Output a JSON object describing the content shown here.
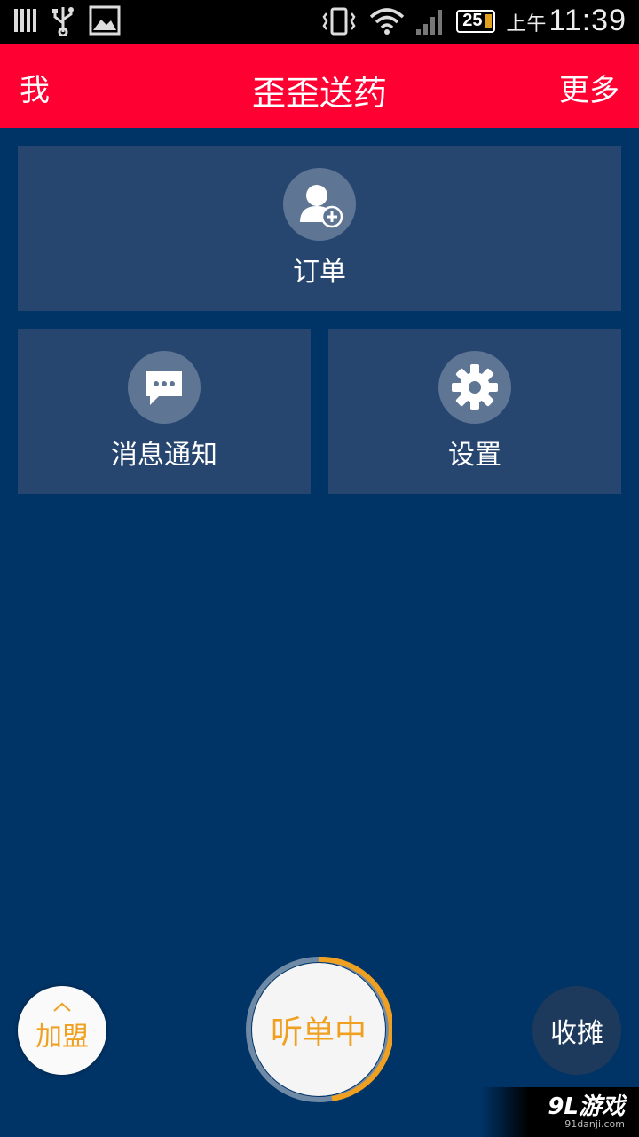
{
  "status_bar": {
    "battery_level": "25",
    "time_prefix": "上午",
    "time": "11:39",
    "icons": [
      "signal-bars-icon",
      "usb-icon",
      "image-icon",
      "vibrate-icon",
      "wifi-icon",
      "cell-signal-icon",
      "battery-icon"
    ]
  },
  "header": {
    "left_label": "我",
    "title": "歪歪送药",
    "right_label": "更多",
    "background": "#ff0033"
  },
  "tiles": {
    "orders": {
      "label": "订单",
      "icon": "user-add-icon"
    },
    "messages": {
      "label": "消息通知",
      "icon": "chat-bubble-icon"
    },
    "settings": {
      "label": "设置",
      "icon": "gear-icon"
    }
  },
  "bottom": {
    "join_label": "加盟",
    "listen_label": "听单中",
    "close_label": "收摊",
    "accent": "#f0a020"
  },
  "watermark": {
    "brand": "9L游戏",
    "site": "91danji.com"
  },
  "colors": {
    "page_background": "#003366",
    "tile_background": "#264670"
  }
}
